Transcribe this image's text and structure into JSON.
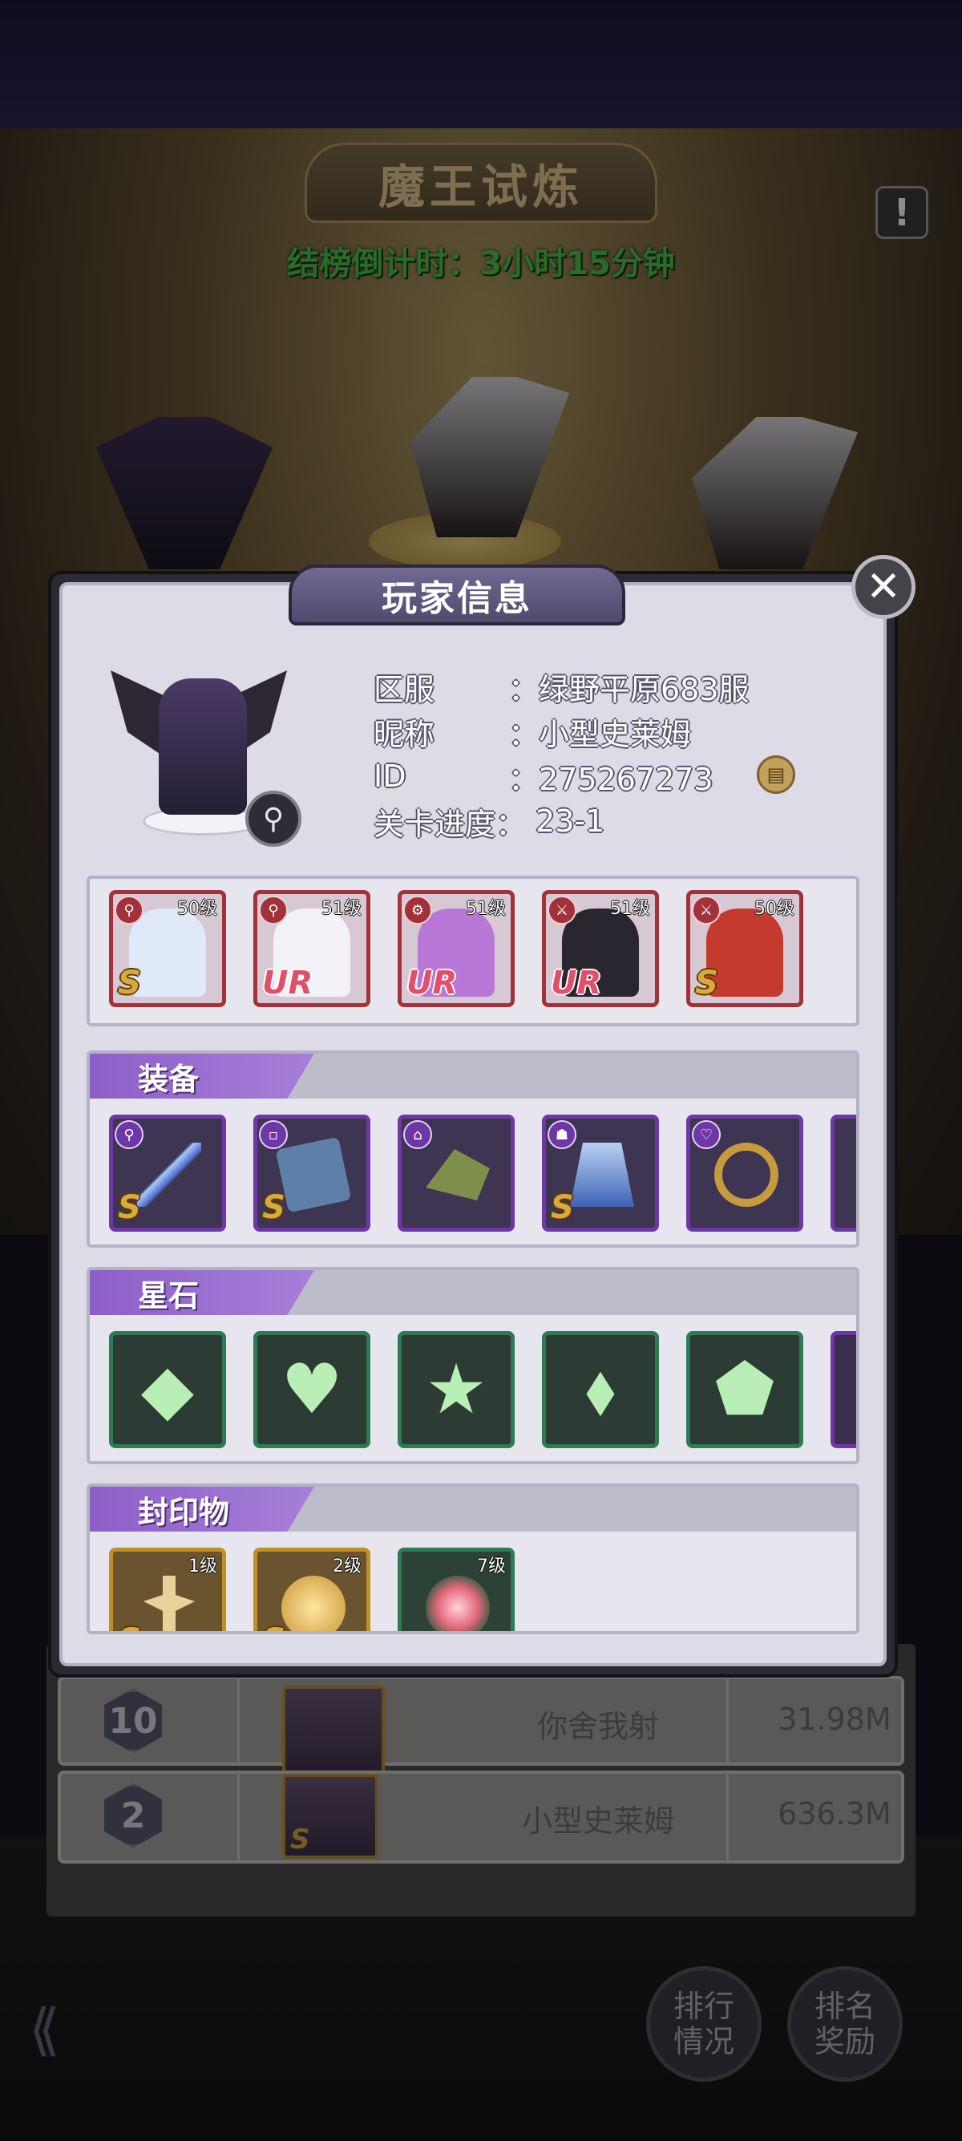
{
  "event": {
    "title": "魔王试炼",
    "countdown": "结榜倒计时：3小时15分钟",
    "info_icon": "exclamation-icon"
  },
  "leaderboard": {
    "rows": [
      {
        "rank": "10",
        "name": "你舍我射",
        "score": "31.98M"
      },
      {
        "rank": "2",
        "name": "小型史莱姆",
        "score": "636.3M",
        "avatar_grade": "S"
      }
    ]
  },
  "bottom_buttons": {
    "ranking_status": "排行\n情况",
    "ranking_rewards": "排名\n奖励",
    "back_icon": "back-arrow-icon"
  },
  "modal": {
    "title": "玩家信息",
    "close_icon": "close-icon",
    "player": {
      "server_label": "区服",
      "server_value": "：绿野平原683服",
      "nickname_label": "昵称",
      "nickname_value": "：小型史莱姆",
      "id_label": "ID",
      "id_value": "：275267273",
      "progress_label": "关卡进度：",
      "progress_value": "23-1",
      "copy_icon": "copy-icon",
      "magnify_icon": "magnify-icon"
    },
    "heroes": [
      {
        "level": "50级",
        "grade": "S",
        "hair": "#dfe9f7"
      },
      {
        "level": "51级",
        "grade": "UR",
        "hair": "#f1f1f6"
      },
      {
        "level": "51级",
        "grade": "UR",
        "hair": "#b978d8"
      },
      {
        "level": "51级",
        "grade": "UR",
        "hair": "#2a2630"
      },
      {
        "level": "50级",
        "grade": "S",
        "hair": "#c43a2f"
      }
    ],
    "equipment": {
      "title": "装备",
      "items": [
        {
          "grade": "S",
          "icon": "staff-icon"
        },
        {
          "grade": "S",
          "icon": "book-icon"
        },
        {
          "grade": "",
          "icon": "hat-icon"
        },
        {
          "grade": "S",
          "icon": "cloak-icon"
        },
        {
          "grade": "",
          "icon": "ring-icon"
        }
      ]
    },
    "star_stones": {
      "title": "星石",
      "items": [
        {
          "icon": "square-gem-icon",
          "glyph": "◆"
        },
        {
          "icon": "heart-gem-icon",
          "glyph": "♥"
        },
        {
          "icon": "star-gem-icon",
          "glyph": "★"
        },
        {
          "icon": "diamond-gem-icon",
          "glyph": "⬧"
        },
        {
          "icon": "drop-gem-icon",
          "glyph": "⬟"
        }
      ]
    },
    "seals": {
      "title": "封印物",
      "items": [
        {
          "level": "1级",
          "grade": "S",
          "icon": "puppet-icon"
        },
        {
          "level": "2级",
          "grade": "S",
          "icon": "coin-icon"
        },
        {
          "level": "7级",
          "grade": "",
          "icon": "firework-flower-icon"
        }
      ]
    }
  },
  "colors": {
    "countdown_green": "#4fc24a",
    "section_purple": "#8c5fc7",
    "hero_frame_red": "#a3313a",
    "equip_frame_purple": "#6e36a6",
    "gem_frame_green": "#2e7a56"
  }
}
